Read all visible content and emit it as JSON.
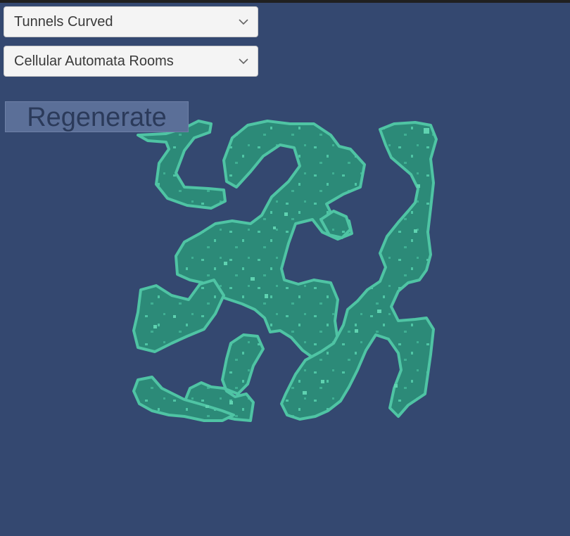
{
  "controls": {
    "generator_dropdown": {
      "selected": "Tunnels Curved"
    },
    "room_dropdown": {
      "selected": "Cellular Automata Rooms"
    },
    "regenerate_label": "Regenerate"
  },
  "colors": {
    "background": "#344870",
    "cave_fill": "#2c8a78",
    "cave_edge": "#4fc4a4",
    "rock_speckle": "#5fd2b0"
  }
}
